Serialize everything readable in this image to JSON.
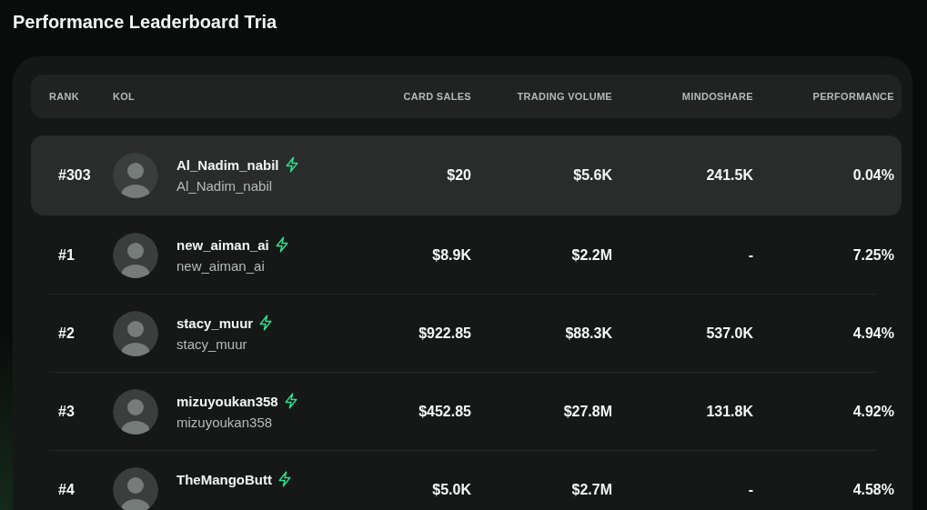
{
  "title": "Performance Leaderboard Tria",
  "table": {
    "columns": [
      "RANK",
      "KOL",
      "CARD SALES",
      "TRADING VOLUME",
      "MINDOSHARE",
      "PERFORMANCE"
    ],
    "rows": [
      {
        "rank": "#303",
        "name": "Al_Nadim_nabil",
        "handle": "Al_Nadim_nabil",
        "card_sales": "$20",
        "trading_volume": "$5.6K",
        "mindoshare": "241.5K",
        "performance": "0.04%",
        "selected": true
      },
      {
        "rank": "#1",
        "name": "new_aiman_ai",
        "handle": "new_aiman_ai",
        "card_sales": "$8.9K",
        "trading_volume": "$2.2M",
        "mindoshare": "-",
        "performance": "7.25%",
        "selected": false
      },
      {
        "rank": "#2",
        "name": "stacy_muur",
        "handle": "stacy_muur",
        "card_sales": "$922.85",
        "trading_volume": "$88.3K",
        "mindoshare": "537.0K",
        "performance": "4.94%",
        "selected": false
      },
      {
        "rank": "#3",
        "name": "mizuyoukan358",
        "handle": "mizuyoukan358",
        "card_sales": "$452.85",
        "trading_volume": "$27.8M",
        "mindoshare": "131.8K",
        "performance": "4.92%",
        "selected": false
      },
      {
        "rank": "#4",
        "name": "TheMangoButt",
        "card_sales": "$5.0K",
        "trading_volume": "$2.7M",
        "mindoshare": "-",
        "performance": "4.58%",
        "selected": false
      }
    ]
  }
}
